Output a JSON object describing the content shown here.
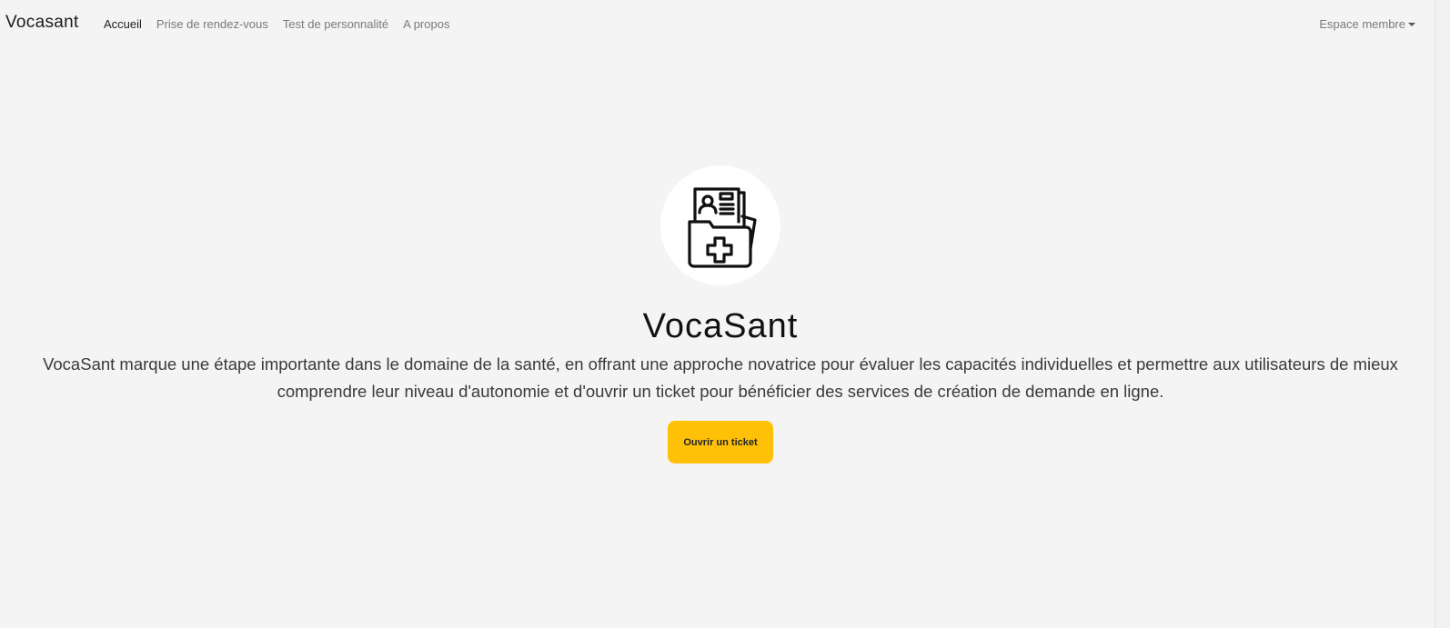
{
  "navbar": {
    "brand": "Vocasant",
    "links": [
      {
        "label": "Accueil",
        "active": true
      },
      {
        "label": "Prise de rendez-vous",
        "active": false
      },
      {
        "label": "Test de personnalité",
        "active": false
      },
      {
        "label": "A propos",
        "active": false
      }
    ],
    "member_menu": "Espace membre"
  },
  "hero": {
    "logo_icon": "medical-folder-icon",
    "title": "VocaSant",
    "description": "VocaSant marque une étape importante dans le domaine de la santé, en offrant une approche novatrice pour évaluer les capacités individuelles et permettre aux utilisateurs de mieux comprendre leur niveau d'autonomie et d'ouvrir un ticket pour bénéficier des services de création de demande en ligne.",
    "cta_label": "Ouvrir un ticket"
  },
  "colors": {
    "background": "#f4f4f4",
    "accent": "#ffc107"
  }
}
